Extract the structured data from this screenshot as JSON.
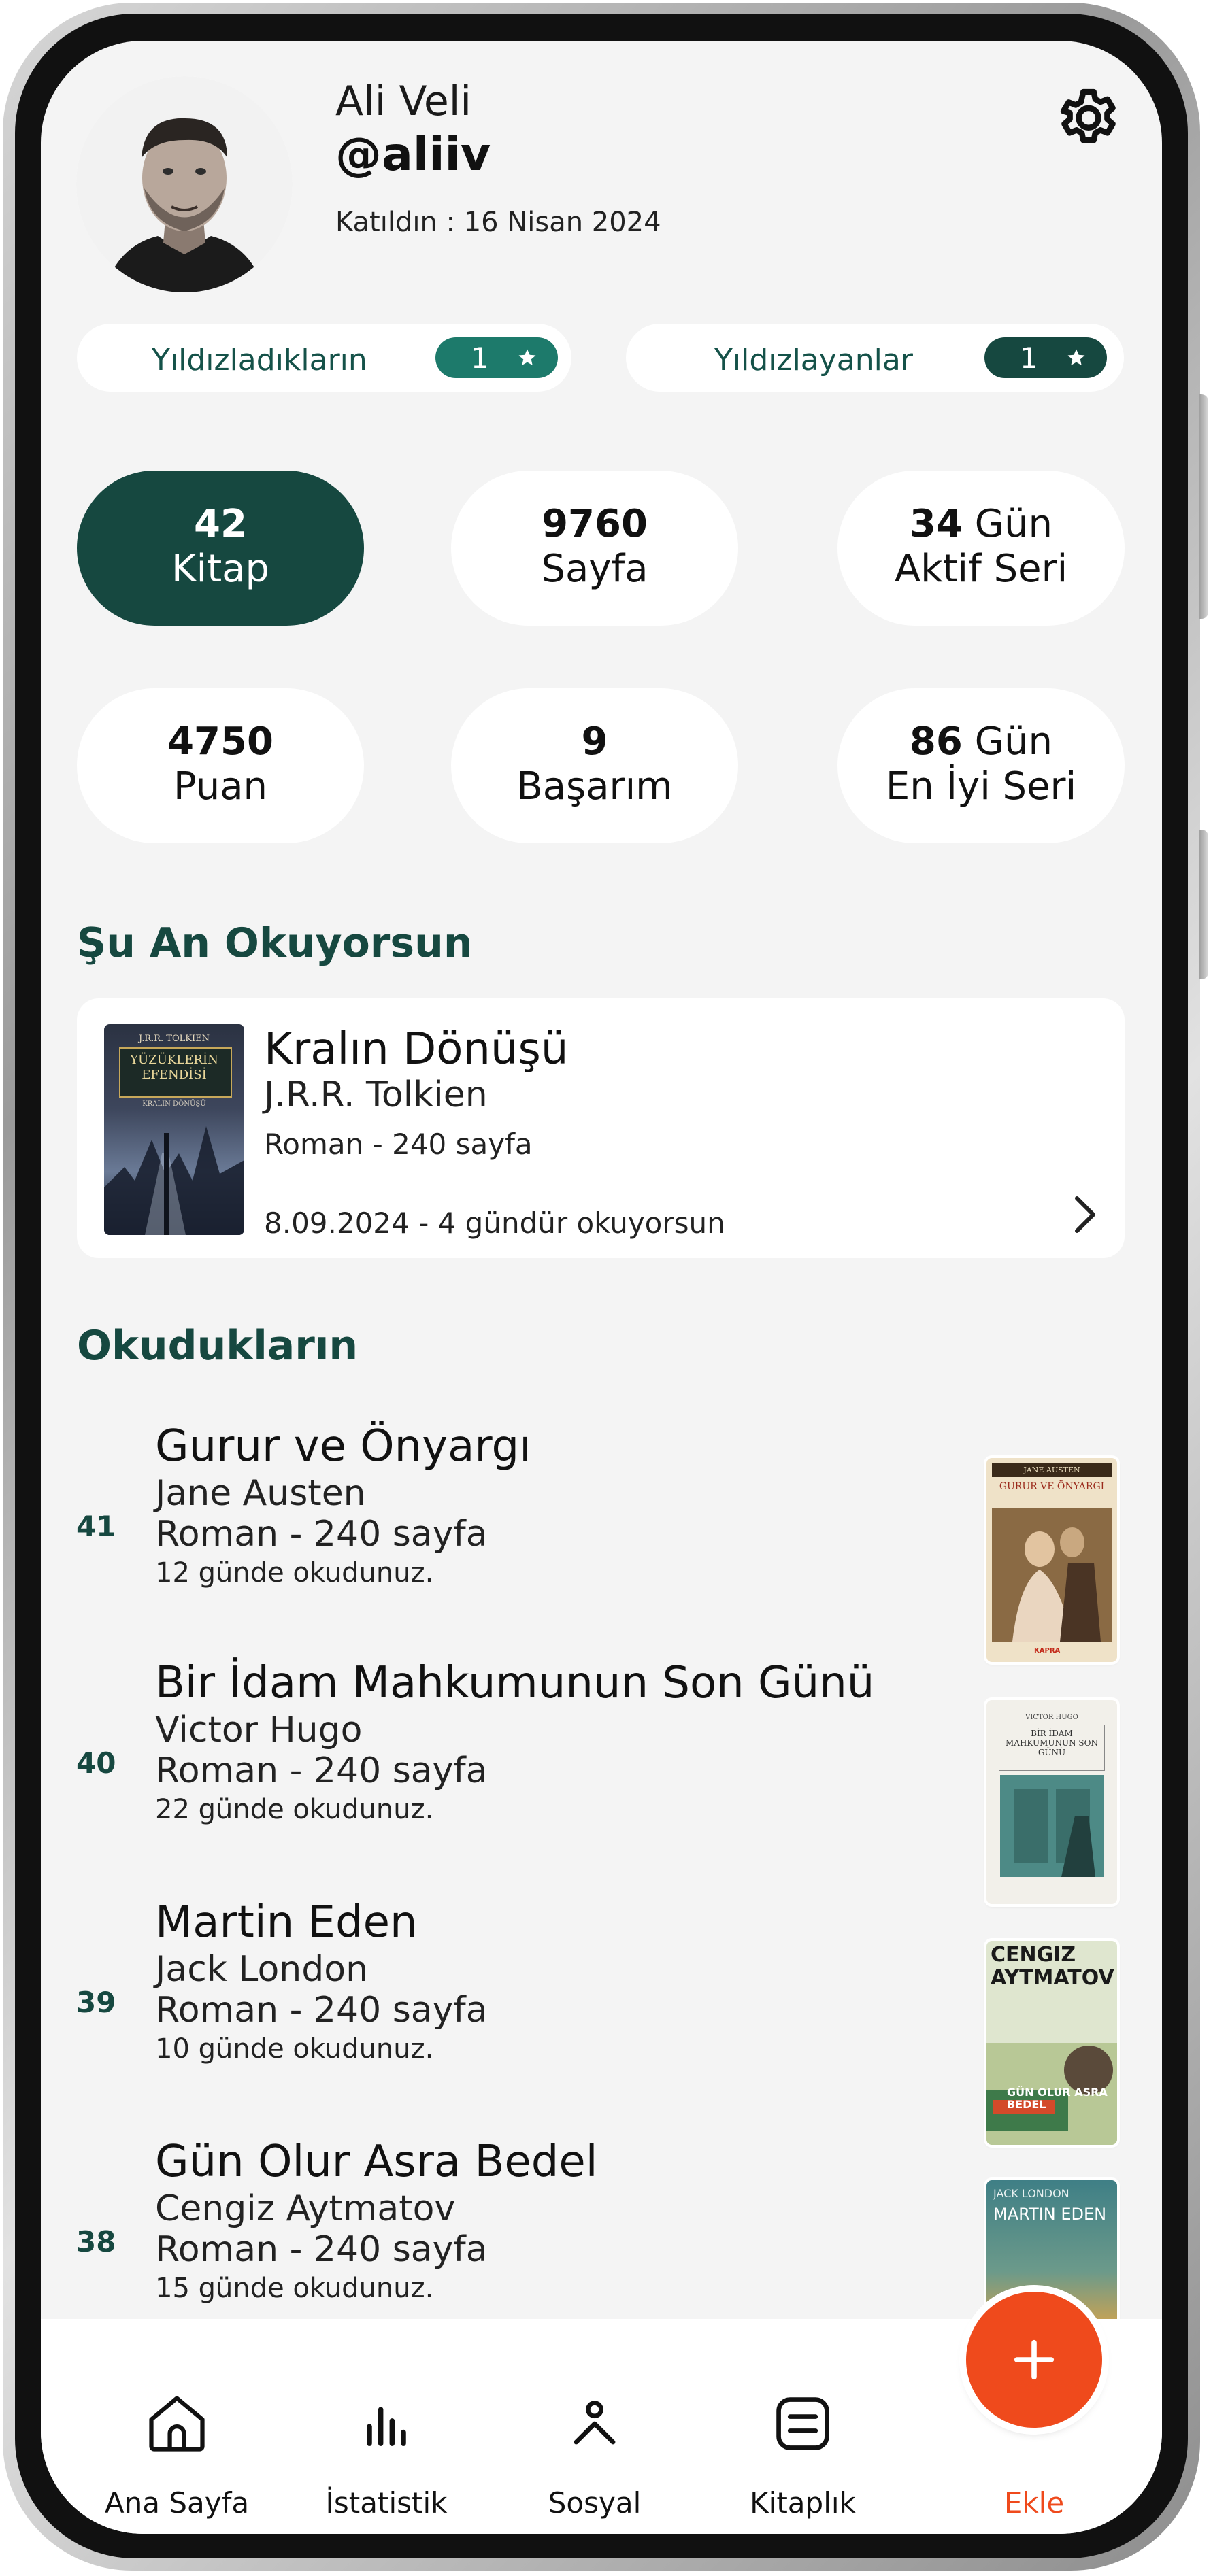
{
  "profile": {
    "name": "Ali Veli",
    "handle": "@aliiv",
    "joined": "Katıldın : 16 Nisan 2024"
  },
  "stars": {
    "starred": {
      "label": "Yıldızladıkların",
      "count": "1"
    },
    "starred_by": {
      "label": "Yıldızlayanlar",
      "count": "1"
    }
  },
  "stats": [
    {
      "value": "42",
      "unit": "",
      "label": "Kitap"
    },
    {
      "value": "9760",
      "unit": "",
      "label": "Sayfa"
    },
    {
      "value": "34",
      "unit": "Gün",
      "label": "Aktif Seri"
    },
    {
      "value": "4750",
      "unit": "",
      "label": "Puan"
    },
    {
      "value": "9",
      "unit": "",
      "label": "Başarım"
    },
    {
      "value": "86",
      "unit": "Gün",
      "label": "En İyi Seri"
    }
  ],
  "current": {
    "section_title": "Şu An Okuyorsun",
    "title": "Kralın Dönüşü",
    "author": "J.R.R. Tolkien",
    "meta": "Roman - 240 sayfa",
    "progress": "8.09.2024 - 4 gündür okuyorsun",
    "cover_author": "J.R.R. TOLKIEN",
    "cover_title": "YÜZÜKLERİN EFENDİSİ",
    "cover_sub": "KRALIN DÖNÜŞÜ"
  },
  "read": {
    "section_title": "Okudukların",
    "books": [
      {
        "rank": "41",
        "title": "Gurur ve Önyargı",
        "author": "Jane Austen",
        "meta": "Roman - 240 sayfa",
        "days": "12 günde okudunuz.",
        "cover_author": "JANE AUSTEN",
        "cover_title": "GURUR VE ÖNYARGI",
        "cover_publisher": "KAPRA"
      },
      {
        "rank": "40",
        "title": "Bir İdam Mahkumunun Son Günü",
        "author": "Victor Hugo",
        "meta": "Roman - 240 sayfa",
        "days": "22 günde okudunuz.",
        "cover_author": "VICTOR HUGO",
        "cover_title": "BİR İDAM MAHKUMUNUN SON GÜNÜ"
      },
      {
        "rank": "39",
        "title": "Martin Eden",
        "author": "Jack London",
        "meta": "Roman - 240 sayfa",
        "days": "10 günde okudunuz.",
        "cover_title": "CENGIZ AYTMATOV",
        "cover_sub": "GÜN OLUR ASRA BEDEL"
      },
      {
        "rank": "38",
        "title": "Gün Olur Asra Bedel",
        "author": "Cengiz Aytmatov",
        "meta": "Roman - 240 sayfa",
        "days": "15 günde okudunuz.",
        "cover_author": "JACK LONDON",
        "cover_title": "MARTIN EDEN"
      }
    ]
  },
  "nav": {
    "home": "Ana Sayfa",
    "stats": "İstatistik",
    "social": "Sosyal",
    "library": "Kitaplık",
    "add": "Ekle"
  },
  "colors": {
    "primary": "#164840",
    "accent_teal": "#1d7a6b",
    "fab": "#ef4a1c",
    "background": "#f4f4f4"
  }
}
